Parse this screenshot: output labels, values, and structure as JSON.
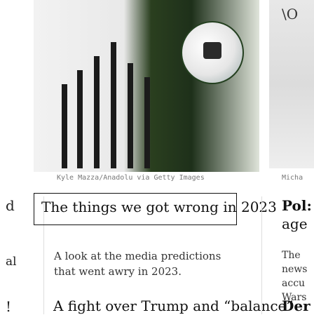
{
  "left_column": {
    "partial_lines": [
      "d",
      "al",
      "!"
    ]
  },
  "main_article": {
    "photo_credit": "Kyle Mazza/Anadolu via Getty Images",
    "headline": "The things we got wrong in 2023",
    "dek": "A look at the media predictions that went awry in 2023.",
    "next_headline": "A fight over Trump and “balance”"
  },
  "right_column": {
    "photo_mark": "\\O",
    "photo_credit": "Micha",
    "headline_lines": [
      "Pol:",
      "age"
    ],
    "body_lines": [
      "The ",
      "news",
      "accu",
      "Wars"
    ],
    "next_headline": "Der"
  },
  "colors": {
    "text": "#111111",
    "muted": "#777777",
    "hero_green": "#244020"
  }
}
